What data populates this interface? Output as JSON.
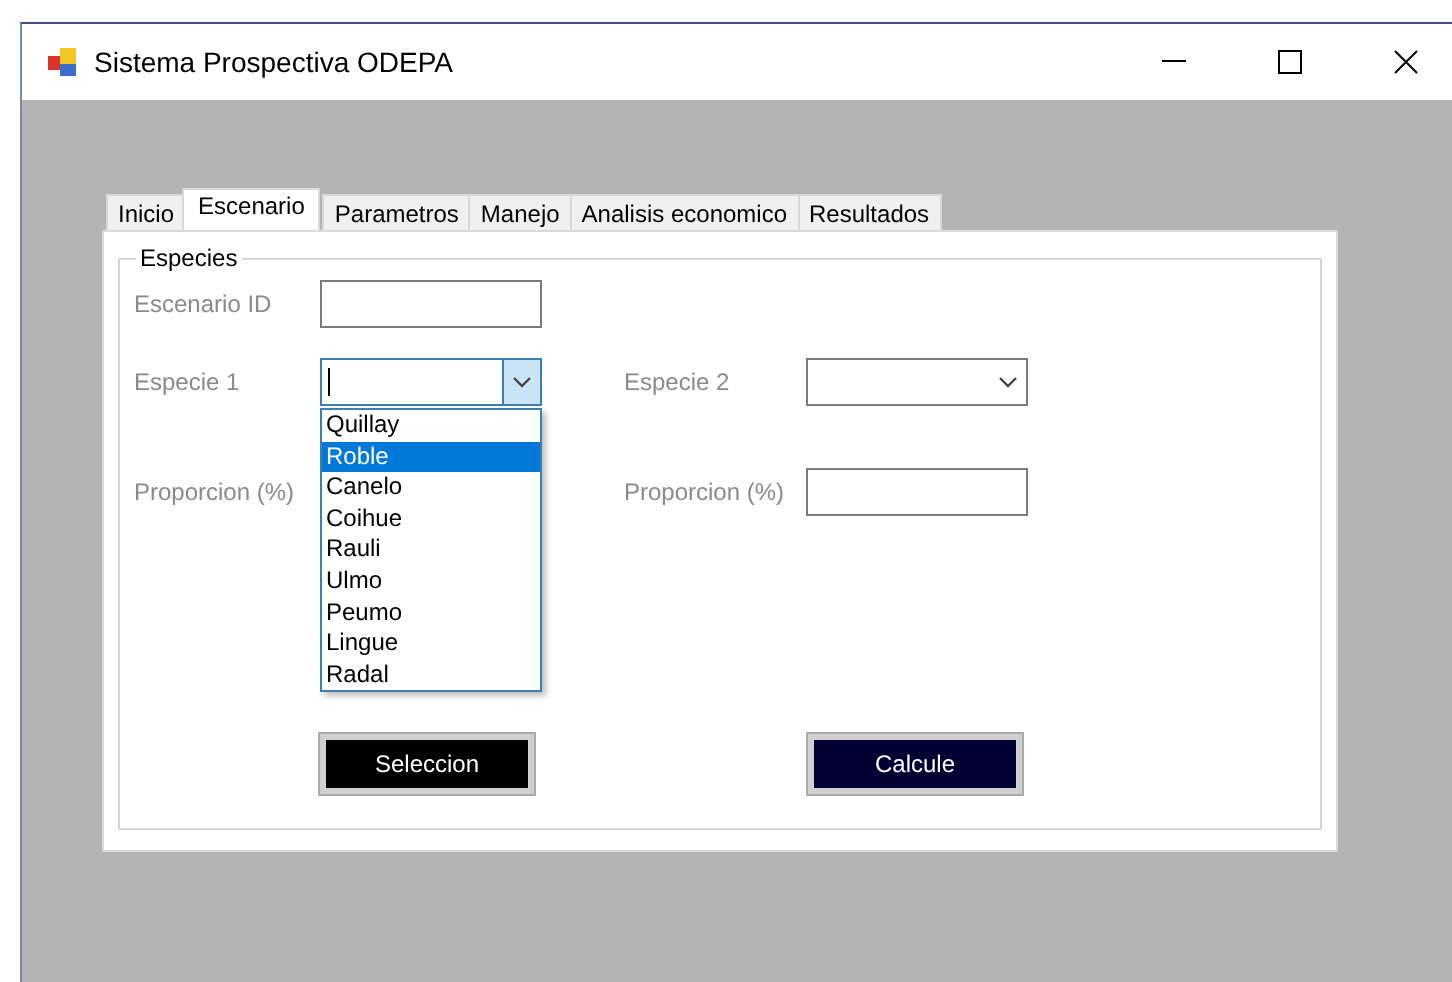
{
  "window": {
    "title": "Sistema Prospectiva ODEPA"
  },
  "tabs": [
    {
      "label": "Inicio",
      "selected": false
    },
    {
      "label": "Escenario",
      "selected": true
    },
    {
      "label": "Parametros",
      "selected": false
    },
    {
      "label": "Manejo",
      "selected": false
    },
    {
      "label": "Analisis economico",
      "selected": false
    },
    {
      "label": "Resultados",
      "selected": false
    }
  ],
  "group": {
    "title": "Especies"
  },
  "escenario_id": {
    "label": "Escenario ID"
  },
  "especie_1": {
    "label": "Especie 1",
    "expanded": true,
    "options": [
      {
        "label": "Quillay",
        "selected": false
      },
      {
        "label": "Roble",
        "selected": true
      },
      {
        "label": "Canelo",
        "selected": false
      },
      {
        "label": "Coihue",
        "selected": false
      },
      {
        "label": "Rauli",
        "selected": false
      },
      {
        "label": "Ulmo",
        "selected": false
      },
      {
        "label": "Peumo",
        "selected": false
      },
      {
        "label": "Lingue",
        "selected": false
      },
      {
        "label": "Radal",
        "selected": false
      }
    ]
  },
  "especie_2": {
    "label": "Especie 2",
    "expanded": false
  },
  "proporcion_1": {
    "label": "Proporcion (%)"
  },
  "proporcion_2": {
    "label": "Proporcion (%)"
  },
  "buttons": [
    {
      "label": "Seleccion",
      "color": "#000000"
    },
    {
      "label": "Calcule",
      "color": "#000033"
    }
  ]
}
